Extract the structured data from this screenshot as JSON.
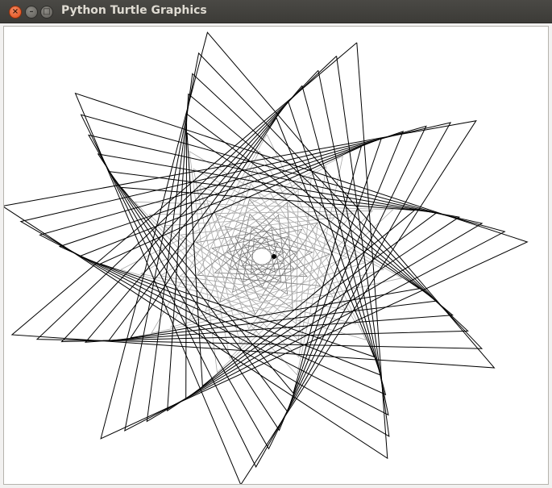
{
  "window": {
    "title": "Python Turtle Graphics",
    "close_icon": "close-icon",
    "minimize_icon": "minimize-icon",
    "maximize_icon": "maximize-icon",
    "close_glyph": "×",
    "minimize_glyph": "–",
    "maximize_glyph": "□"
  },
  "canvas": {
    "background": "#ffffff",
    "pen_color": "#000000",
    "pattern": "spiral-star",
    "star_points": 11,
    "star_step": 4,
    "layers": 14
  }
}
